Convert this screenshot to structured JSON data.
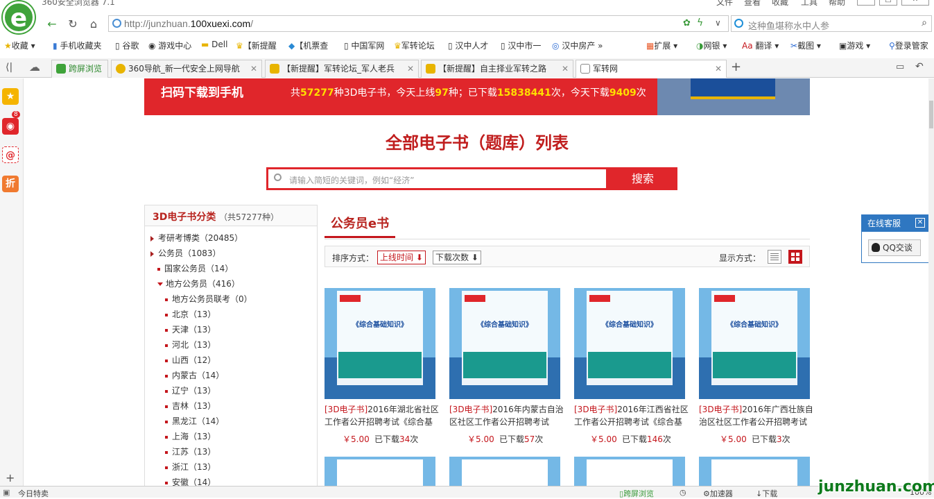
{
  "browser": {
    "title": "360安全浏览器 7.1",
    "menus": [
      "文件",
      "查看",
      "收藏",
      "工具",
      "帮助"
    ],
    "url_prefix": "http://junzhuan.",
    "url_domain": "100xuexi.com",
    "url_suffix": "/",
    "search_placeholder": "这种鱼堪称水中人参"
  },
  "bookmarks": [
    "收藏",
    "手机收藏夹",
    "谷歌",
    "游戏中心",
    "Dell",
    "【新提醒",
    "【机票查",
    "中国军网",
    "军转论坛",
    "汉中人才",
    "汉中市一",
    "汉中房产",
    "扩展",
    "网银",
    "翻译",
    "截图",
    "游戏",
    "登录管家"
  ],
  "tabs": [
    {
      "label": "跨屏浏览"
    },
    {
      "label": "360导航_新一代安全上网导航"
    },
    {
      "label": "【新提醒】军转论坛_军人老兵"
    },
    {
      "label": "【新提醒】自主择业军转之路"
    },
    {
      "label": "军转网"
    }
  ],
  "sidebar": {
    "badge": "8"
  },
  "banner": {
    "left": "扫码下载到手机",
    "p1": "共",
    "total": "57277",
    "p2": "种3D电子书，今天上线",
    "today": "97",
    "p3": "种；已下载",
    "dl": "15838441",
    "p4": "次，今天下载",
    "dltoday": "9409",
    "p5": "次"
  },
  "page": {
    "heading": "全部电子书（题库）列表",
    "search_placeholder": "请输入简短的关键词，例如“经济”",
    "search_button": "搜索"
  },
  "categories": {
    "title": "3D电子书分类",
    "count": "（共57277种）",
    "items": [
      {
        "label": "考研考博类（20485）",
        "level": 0
      },
      {
        "label": "公务员（1083）",
        "level": 0
      },
      {
        "label": "国家公务员（14）",
        "level": 1
      },
      {
        "label": "地方公务员（416）",
        "level": 1,
        "open": true
      },
      {
        "label": "地方公务员联考（0）",
        "level": 2
      },
      {
        "label": "北京（13）",
        "level": 2
      },
      {
        "label": "天津（13）",
        "level": 2
      },
      {
        "label": "河北（13）",
        "level": 2
      },
      {
        "label": "山西（12）",
        "level": 2
      },
      {
        "label": "内蒙古（14）",
        "level": 2
      },
      {
        "label": "辽宁（13）",
        "level": 2
      },
      {
        "label": "吉林（13）",
        "level": 2
      },
      {
        "label": "黑龙江（14）",
        "level": 2
      },
      {
        "label": "上海（13）",
        "level": 2
      },
      {
        "label": "江苏（13）",
        "level": 2
      },
      {
        "label": "浙江（13）",
        "level": 2
      },
      {
        "label": "安徽（14）",
        "level": 2
      }
    ]
  },
  "section": {
    "title": "公务员e书",
    "sort_label": "排序方式：",
    "sort_time": "上线时间",
    "sort_dl": "下载次数",
    "view_label": "显示方式："
  },
  "books": [
    {
      "tag": "[3D电子书]",
      "title": "2016年湖北省社区工作者公开招聘考试《综合基",
      "price": "￥5.00",
      "dl_pre": "已下载",
      "dl": "34",
      "dl_post": "次",
      "cover": "《综合基础知识》"
    },
    {
      "tag": "[3D电子书]",
      "title": "2016年内蒙古自治区社区工作者公开招聘考试",
      "price": "￥5.00",
      "dl_pre": "已下载",
      "dl": "57",
      "dl_post": "次",
      "cover": "《综合基础知识》"
    },
    {
      "tag": "[3D电子书]",
      "title": "2016年江西省社区工作者公开招聘考试《综合基",
      "price": "￥5.00",
      "dl_pre": "已下载",
      "dl": "146",
      "dl_post": "次",
      "cover": "《综合基础知识》"
    },
    {
      "tag": "[3D电子书]",
      "title": "2016年广西壮族自治区社区工作者公开招聘考试",
      "price": "￥5.00",
      "dl_pre": "已下载",
      "dl": "3",
      "dl_post": "次",
      "cover": "《综合基础知识》"
    }
  ],
  "kefu": {
    "title": "在线客服",
    "qq": "QQ交谈"
  },
  "status": {
    "left": "今日特卖",
    "cross": "跨屏浏览",
    "accel": "加速器",
    "download": "下载",
    "zoom": "100%"
  },
  "watermark": "junzhuan.com",
  "colors": {
    "accent": "#e0262b",
    "brand_green": "#3fa33a"
  }
}
